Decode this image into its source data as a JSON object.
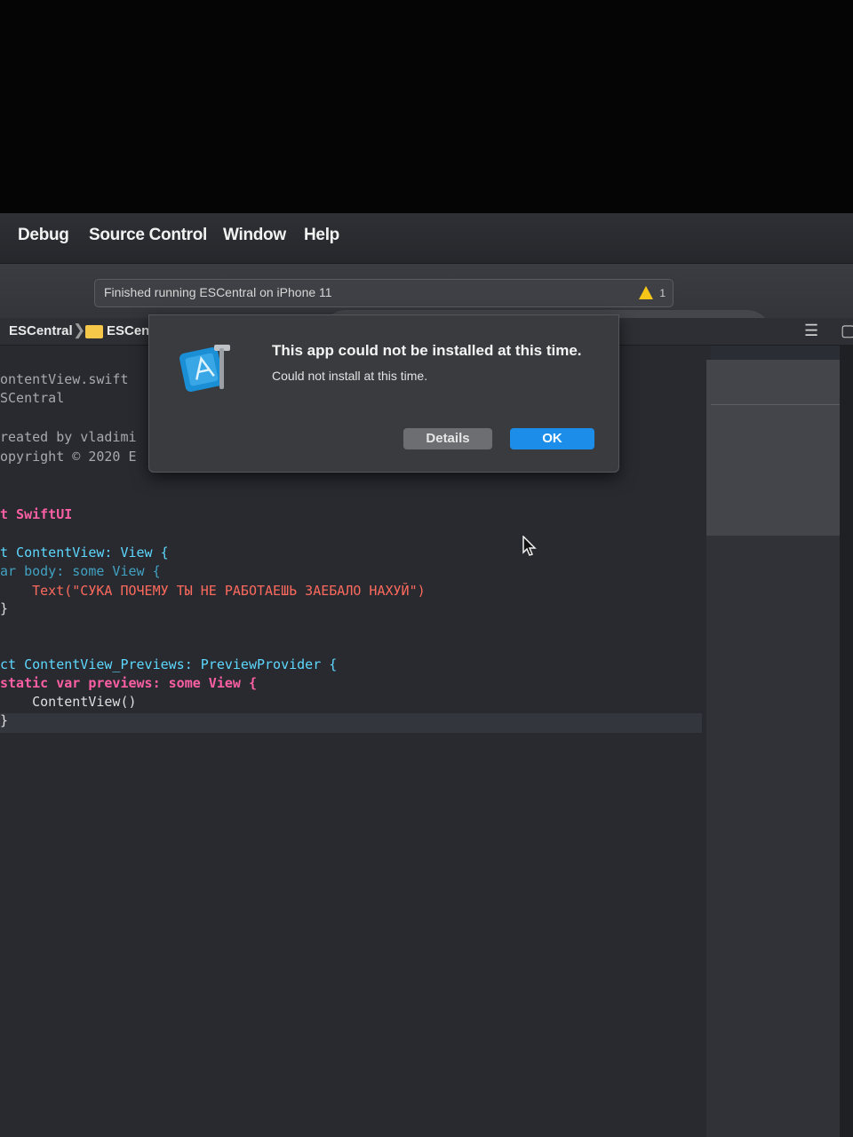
{
  "menubar": {
    "items": [
      "Debug",
      "Source Control",
      "Window",
      "Help"
    ]
  },
  "activity": {
    "status": "Finished running ESCentral on iPhone 11",
    "warning_count": "1"
  },
  "jumpbar": {
    "crumbs": [
      "ESCentral",
      "ESCen"
    ]
  },
  "editor": {
    "lines": [
      "ontentView.swift",
      "SCentral",
      "reated by vladimi",
      "opyright © 2020 E",
      "t SwiftUI",
      "t ContentView: View {",
      "ar body: some View {",
      "    Text(\"СУКА ПОЧЕМУ ТЫ НЕ РАБОТАЕШЬ ЗАЕБАЛО НАХУЙ\")",
      "}",
      "ct ContentView_Previews: PreviewProvider {",
      "static var previews: some View {",
      "    ContentView()",
      "}"
    ]
  },
  "alert": {
    "title": "This app could not be installed at this time.",
    "message": "Could not install at this time.",
    "details_label": "Details",
    "ok_label": "OK"
  },
  "colors": {
    "keyword": "#fc5fa3",
    "type": "#5dd8ff",
    "string": "#fc6a5d",
    "ok_button": "#1c8eea"
  }
}
